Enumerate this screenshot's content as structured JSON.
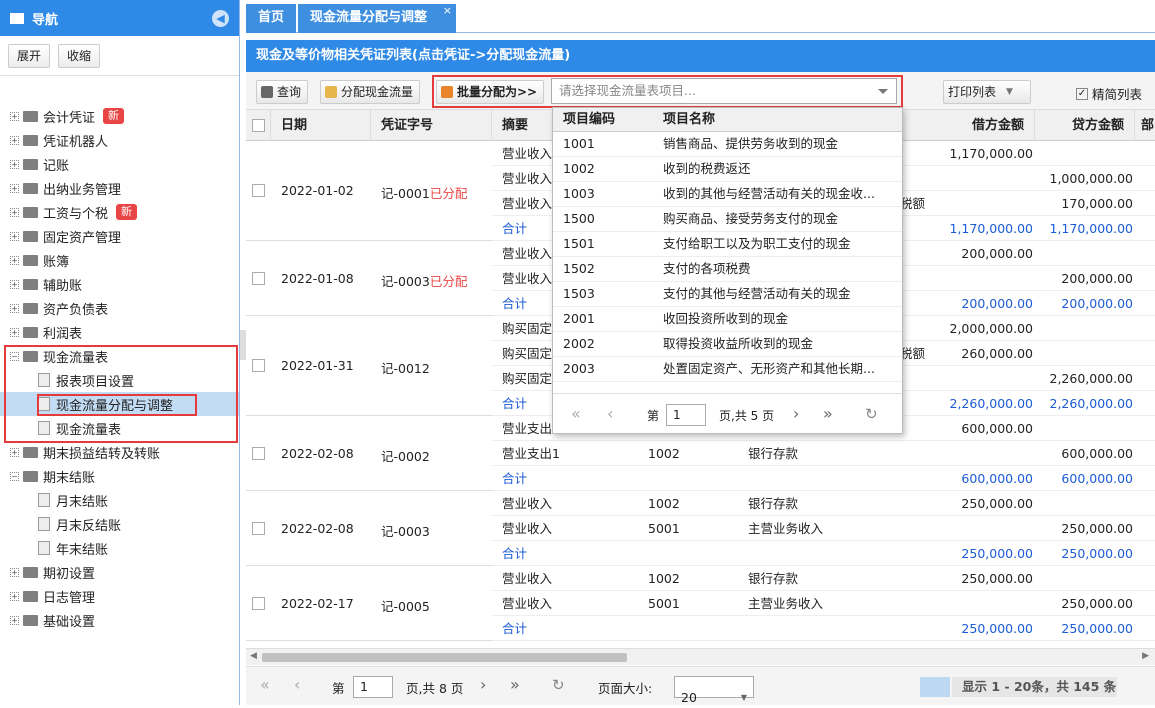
{
  "nav": {
    "title": "导航",
    "expand": "展开",
    "collapse": "收缩",
    "items": [
      {
        "label": "会计凭证",
        "badge": "新"
      },
      {
        "label": "凭证机器人"
      },
      {
        "label": "记账"
      },
      {
        "label": "出纳业务管理"
      },
      {
        "label": "工资与个税",
        "badge": "新"
      },
      {
        "label": "固定资产管理"
      },
      {
        "label": "账簿"
      },
      {
        "label": "辅助账"
      },
      {
        "label": "资产负债表"
      },
      {
        "label": "利润表"
      },
      {
        "label": "现金流量表"
      }
    ],
    "cashflow_children": [
      "报表项目设置",
      "现金流量分配与调整",
      "现金流量表"
    ],
    "after": [
      "期末损益结转及转账",
      "期末结账"
    ],
    "close_children": [
      "月末结账",
      "月末反结账",
      "年末结账"
    ],
    "tail": [
      "期初设置",
      "日志管理",
      "基础设置"
    ]
  },
  "tabs": {
    "home": "首页",
    "current": "现金流量分配与调整",
    "close": "×"
  },
  "panel_title": "现金及等价物相关凭证列表(点击凭证->分配现金流量)",
  "toolbar": {
    "query": "查询",
    "assign": "分配现金流量",
    "batch": "批量分配为>>",
    "combo_placeholder": "请选择现金流量表项目...",
    "print": "打印列表",
    "simple": "精简列表"
  },
  "columns": {
    "date": "日期",
    "voucher": "凭证字号",
    "summary": "摘要",
    "debit": "借方金额",
    "credit": "贷方金额",
    "dept": "部"
  },
  "rows": [
    {
      "date": "2022-01-02",
      "voucher": "记-0001",
      "status": "已分配",
      "lines": [
        {
          "summary": "营业收入",
          "debit": "1,170,000.00",
          "credit": ""
        },
        {
          "summary": "营业收入",
          "debit": "",
          "credit": "1,000,000.00"
        },
        {
          "summary": "营业收入",
          "extra": "税额",
          "debit": "",
          "credit": "170,000.00"
        },
        {
          "summary": "合计",
          "debit": "1,170,000.00",
          "credit": "1,170,000.00",
          "total": true
        }
      ]
    },
    {
      "date": "2022-01-08",
      "voucher": "记-0003",
      "status": "已分配",
      "lines": [
        {
          "summary": "营业收入",
          "debit": "200,000.00",
          "credit": ""
        },
        {
          "summary": "营业收入",
          "debit": "",
          "credit": "200,000.00"
        },
        {
          "summary": "合计",
          "debit": "200,000.00",
          "credit": "200,000.00",
          "total": true
        }
      ]
    },
    {
      "date": "2022-01-31",
      "voucher": "记-0012",
      "status": "",
      "lines": [
        {
          "summary": "购买固定",
          "debit": "2,000,000.00",
          "credit": ""
        },
        {
          "summary": "购买固定",
          "extra": "税额",
          "debit": "260,000.00",
          "credit": ""
        },
        {
          "summary": "购买固定",
          "debit": "",
          "credit": "2,260,000.00"
        },
        {
          "summary": "合计",
          "debit": "2,260,000.00",
          "credit": "2,260,000.00",
          "total": true
        }
      ]
    },
    {
      "date": "2022-02-08",
      "voucher": "记-0002",
      "status": "",
      "lines": [
        {
          "summary": "营业支出",
          "debit": "600,000.00",
          "credit": ""
        },
        {
          "summary": "营业支出1",
          "code": "1002",
          "account": "银行存款",
          "debit": "",
          "credit": "600,000.00"
        },
        {
          "summary": "合计",
          "debit": "600,000.00",
          "credit": "600,000.00",
          "total": true
        }
      ]
    },
    {
      "date": "2022-02-08",
      "voucher": "记-0003",
      "status": "",
      "lines": [
        {
          "summary": "营业收入",
          "code": "1002",
          "account": "银行存款",
          "debit": "250,000.00",
          "credit": ""
        },
        {
          "summary": "营业收入",
          "code": "5001",
          "account": "主营业务收入",
          "debit": "",
          "credit": "250,000.00"
        },
        {
          "summary": "合计",
          "debit": "250,000.00",
          "credit": "250,000.00",
          "total": true
        }
      ]
    },
    {
      "date": "2022-02-17",
      "voucher": "记-0005",
      "status": "",
      "lines": [
        {
          "summary": "营业收入",
          "code": "1002",
          "account": "银行存款",
          "debit": "250,000.00",
          "credit": ""
        },
        {
          "summary": "营业收入",
          "code": "5001",
          "account": "主营业务收入",
          "debit": "",
          "credit": "250,000.00"
        },
        {
          "summary": "合计",
          "debit": "250,000.00",
          "credit": "250,000.00",
          "total": true
        }
      ]
    }
  ],
  "dropdown": {
    "col_code": "项目编码",
    "col_name": "项目名称",
    "items": [
      {
        "code": "1001",
        "name": "销售商品、提供劳务收到的现金"
      },
      {
        "code": "1002",
        "name": "收到的税费返还"
      },
      {
        "code": "1003",
        "name": "收到的其他与经营活动有关的现金收..."
      },
      {
        "code": "1500",
        "name": "购买商品、接受劳务支付的现金"
      },
      {
        "code": "1501",
        "name": "支付给职工以及为职工支付的现金"
      },
      {
        "code": "1502",
        "name": "支付的各项税费"
      },
      {
        "code": "1503",
        "name": "支付的其他与经营活动有关的现金"
      },
      {
        "code": "2001",
        "name": "收回投资所收到的现金"
      },
      {
        "code": "2002",
        "name": "取得投资收益所收到的现金"
      },
      {
        "code": "2003",
        "name": "处置固定资产、无形资产和其他长期..."
      }
    ],
    "page_label": "第",
    "page": "1",
    "page_total": "页,共 5 页"
  },
  "pager": {
    "page_label": "第",
    "page": "1",
    "page_total": "页,共 8 页",
    "size_label": "页面大小:",
    "size": "20",
    "summary": "显示 1 - 20条，共 145 条"
  }
}
